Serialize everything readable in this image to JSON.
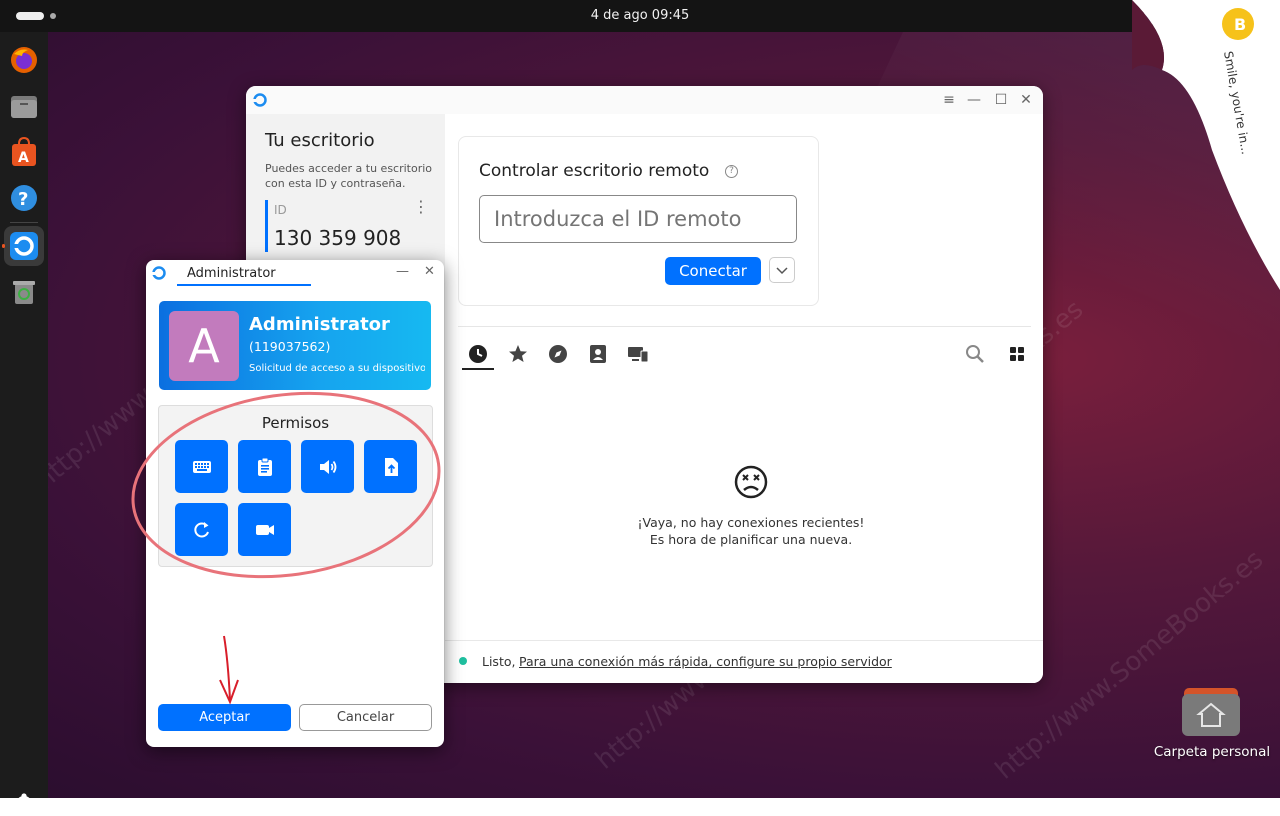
{
  "topbar": {
    "clock": "4 de ago  09:45"
  },
  "dock": {
    "items": [
      "firefox",
      "files",
      "app-center",
      "help",
      "rustdesk",
      "trash"
    ]
  },
  "main_window": {
    "sidebar": {
      "title": "Tu escritorio",
      "description": "Puedes acceder a tu escritorio con esta ID y contraseña.",
      "id_label": "ID",
      "id_value": "130 359 908"
    },
    "remote": {
      "title": "Controlar escritorio remoto",
      "input_placeholder": "Introduzca el ID remoto",
      "connect_label": "Conectar"
    },
    "empty_state": {
      "line1": "¡Vaya, no hay conexiones recientes!",
      "line2": "Es hora de planificar una nueva."
    },
    "status": {
      "ready": "Listo,",
      "link": "Para una conexión más rápida, configure su propio servidor"
    }
  },
  "dialog": {
    "tab_label": "Administrator",
    "user_name": "Administrator",
    "user_id": "(119037562)",
    "request_text": "Solicitud de acceso a su dispositivo...",
    "avatar_letter": "A",
    "permissions_title": "Permisos",
    "accept_label": "Aceptar",
    "cancel_label": "Cancelar"
  },
  "desktop": {
    "folder_label": "Carpeta personal"
  },
  "watermark": {
    "text": "http://www.SomeBooks.es"
  },
  "brand": {
    "curl_text": "Smile, you're in..."
  },
  "colors": {
    "accent": "#0071ff",
    "status_dot": "#1fbf9f",
    "annotation": "#e8737a"
  }
}
